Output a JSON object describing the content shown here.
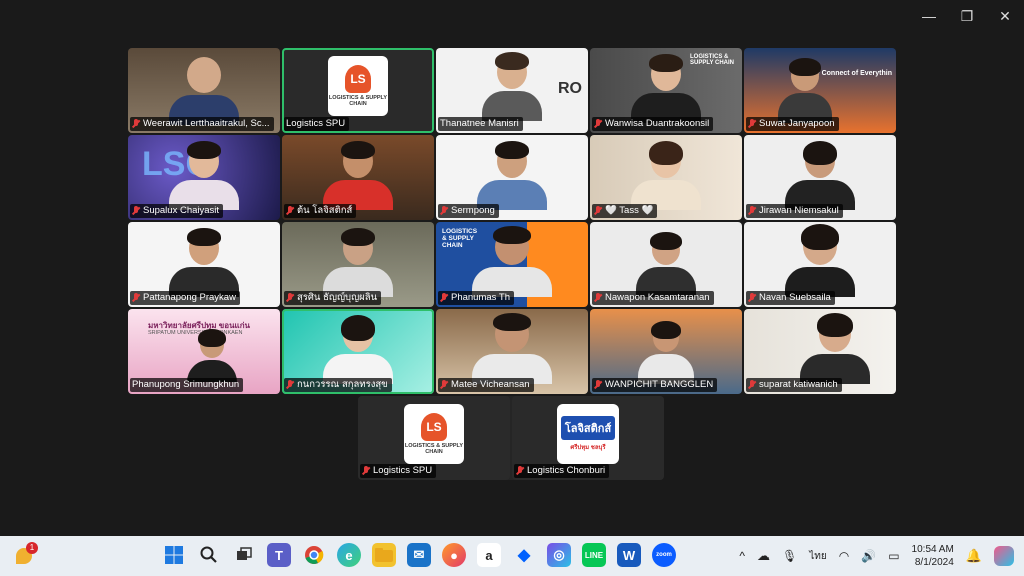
{
  "window_controls": {
    "minimize": "—",
    "maximize": "❐",
    "close": "✕"
  },
  "participants": [
    {
      "name": "Weerawit Lertthaaitrakul, Sc..."
    },
    {
      "name": "Logistics SPU"
    },
    {
      "name": "Thanatnee Manisri"
    },
    {
      "name": "Wanwisa Duantrakoonsil"
    },
    {
      "name": "Suwat Janyapoon"
    },
    {
      "name": "Supalux Chaiyasit"
    },
    {
      "name": "ต้น โลจิสติกส์"
    },
    {
      "name": "Sermpong"
    },
    {
      "name": "🤍 Tass 🤍"
    },
    {
      "name": "Jirawan Niemsakul"
    },
    {
      "name": "Pattanapong Praykaw"
    },
    {
      "name": "สุรศิน ธัญญ์บุญผลิน"
    },
    {
      "name": "Phanumas Th"
    },
    {
      "name": "Nawapon Kasamtaranan"
    },
    {
      "name": "Navan Suebsaila"
    },
    {
      "name": "Phanupong Srimungkhun"
    },
    {
      "name": "กนกวรรณ สกุลทรงสุข"
    },
    {
      "name": "Matee Vicheansan"
    },
    {
      "name": "WANPICHIT BANGGLEN"
    },
    {
      "name": "suparat katiwanich"
    }
  ],
  "bottom_participants": [
    {
      "name": "Logistics SPU"
    },
    {
      "name": "Logistics Chonburi"
    }
  ],
  "logos": {
    "spu_mark": "LS",
    "spu_text": "LOGISTICS & SUPPLY CHAIN",
    "chonburi_text": "โลจิสติกส์",
    "chonburi_sub": "ศรีปทุม ชลบุรี"
  },
  "banners": {
    "tile4_title": "LOGISTICS & SUPPLY CHAIN",
    "tile5_title": "The Connect of Everythin",
    "tile6_text": "LSC",
    "tile13_title": "LOGISTICS & SUPPLY CHAIN",
    "tile16_title": "มหาวิทยาลัยศรีปทุม ขอนแก่น",
    "tile16_sub": "SRIPATUM UNIVERSITY KHONKAEN",
    "tile3_text": "RO"
  },
  "taskbar": {
    "notif_badge": "1",
    "lang": "ไทย",
    "time": "10:54 AM",
    "date": "8/1/2024"
  }
}
